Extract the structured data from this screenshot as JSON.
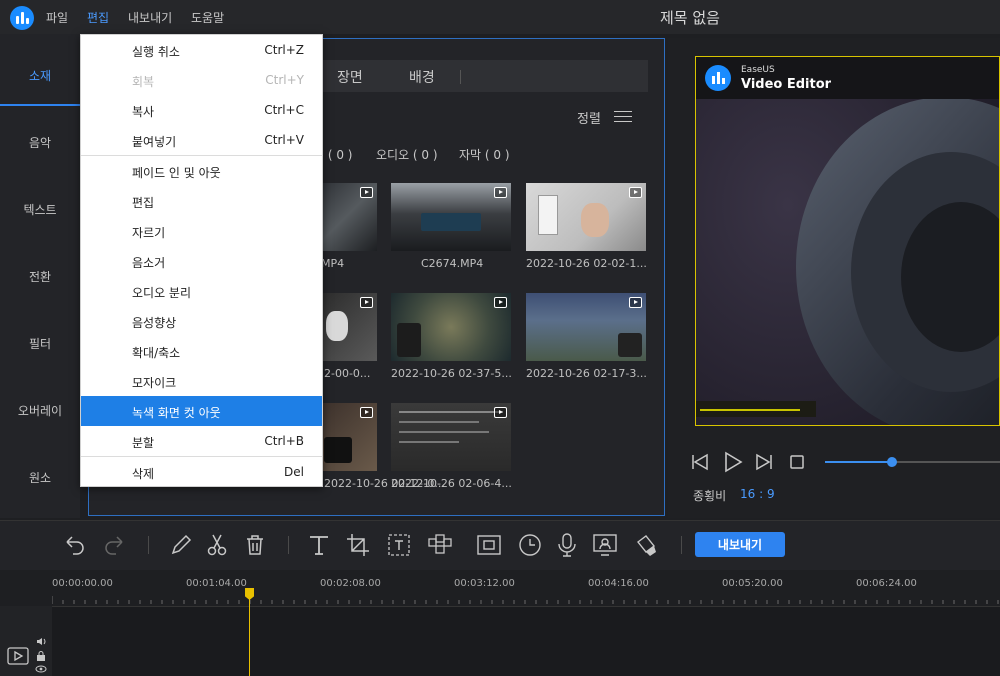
{
  "window": {
    "title": "제목 없음"
  },
  "menubar": {
    "items": [
      "파일",
      "편집",
      "내보내기",
      "도움말"
    ],
    "active_index": 1
  },
  "rail": {
    "items": [
      "소재",
      "음악",
      "텍스트",
      "전환",
      "필터",
      "오버레이",
      "원소"
    ],
    "active_index": 0
  },
  "media": {
    "tabs": [
      "장면",
      "배경"
    ],
    "sort_label": "정렬",
    "filters": [
      "미 ( 0 )",
      "오디오 ( 0 )",
      "자막 ( 0 )"
    ],
    "captions": [
      "MP4",
      "C2674.MP4",
      "2022-10-26 02-02-1...",
      "2-00-0...",
      "2022-10-26 02-37-5...",
      "2022-10-26 02-17-3...",
      "2022-10-26 02-12-0...",
      "2022-10-26 02-06-4..."
    ]
  },
  "edit_menu": {
    "items": [
      {
        "label": "실행 취소",
        "shortcut": "Ctrl+Z",
        "disabled": false
      },
      {
        "label": "회복",
        "shortcut": "Ctrl+Y",
        "disabled": true
      },
      {
        "label": "복사",
        "shortcut": "Ctrl+C",
        "disabled": false
      },
      {
        "label": "붙여넣기",
        "shortcut": "Ctrl+V",
        "disabled": false
      },
      {
        "label": "페이드 인 및 아웃",
        "shortcut": "",
        "disabled": false
      },
      {
        "label": "편집",
        "shortcut": "",
        "disabled": false
      },
      {
        "label": "자르기",
        "shortcut": "",
        "disabled": false
      },
      {
        "label": "음소거",
        "shortcut": "",
        "disabled": false
      },
      {
        "label": "오디오 분리",
        "shortcut": "",
        "disabled": false
      },
      {
        "label": "음성향상",
        "shortcut": "",
        "disabled": false
      },
      {
        "label": "확대/축소",
        "shortcut": "",
        "disabled": false
      },
      {
        "label": "모자이크",
        "shortcut": "",
        "disabled": false
      },
      {
        "label": "녹색 화면 컷 아웃",
        "shortcut": "",
        "disabled": false,
        "hovered": true
      },
      {
        "label": "분할",
        "shortcut": "Ctrl+B",
        "disabled": false
      },
      {
        "label": "삭제",
        "shortcut": "Del",
        "disabled": false
      }
    ]
  },
  "preview": {
    "brand_small": "EaseUS",
    "brand_big": "Video Editor",
    "ratio_label": "종횡비",
    "ratio_value": "16 : 9",
    "volume": 0.38
  },
  "toolbar": {
    "export_label": "내보내기"
  },
  "timeline": {
    "ticks": [
      "00:00:00.00",
      "00:01:04.00",
      "00:02:08.00",
      "00:03:12.00",
      "00:04:16.00",
      "00:05:20.00",
      "00:06:24.00"
    ]
  },
  "colors": {
    "accent": "#2e83f0",
    "playhead": "#e8c000",
    "menu_highlight": "#1e7fe6"
  }
}
